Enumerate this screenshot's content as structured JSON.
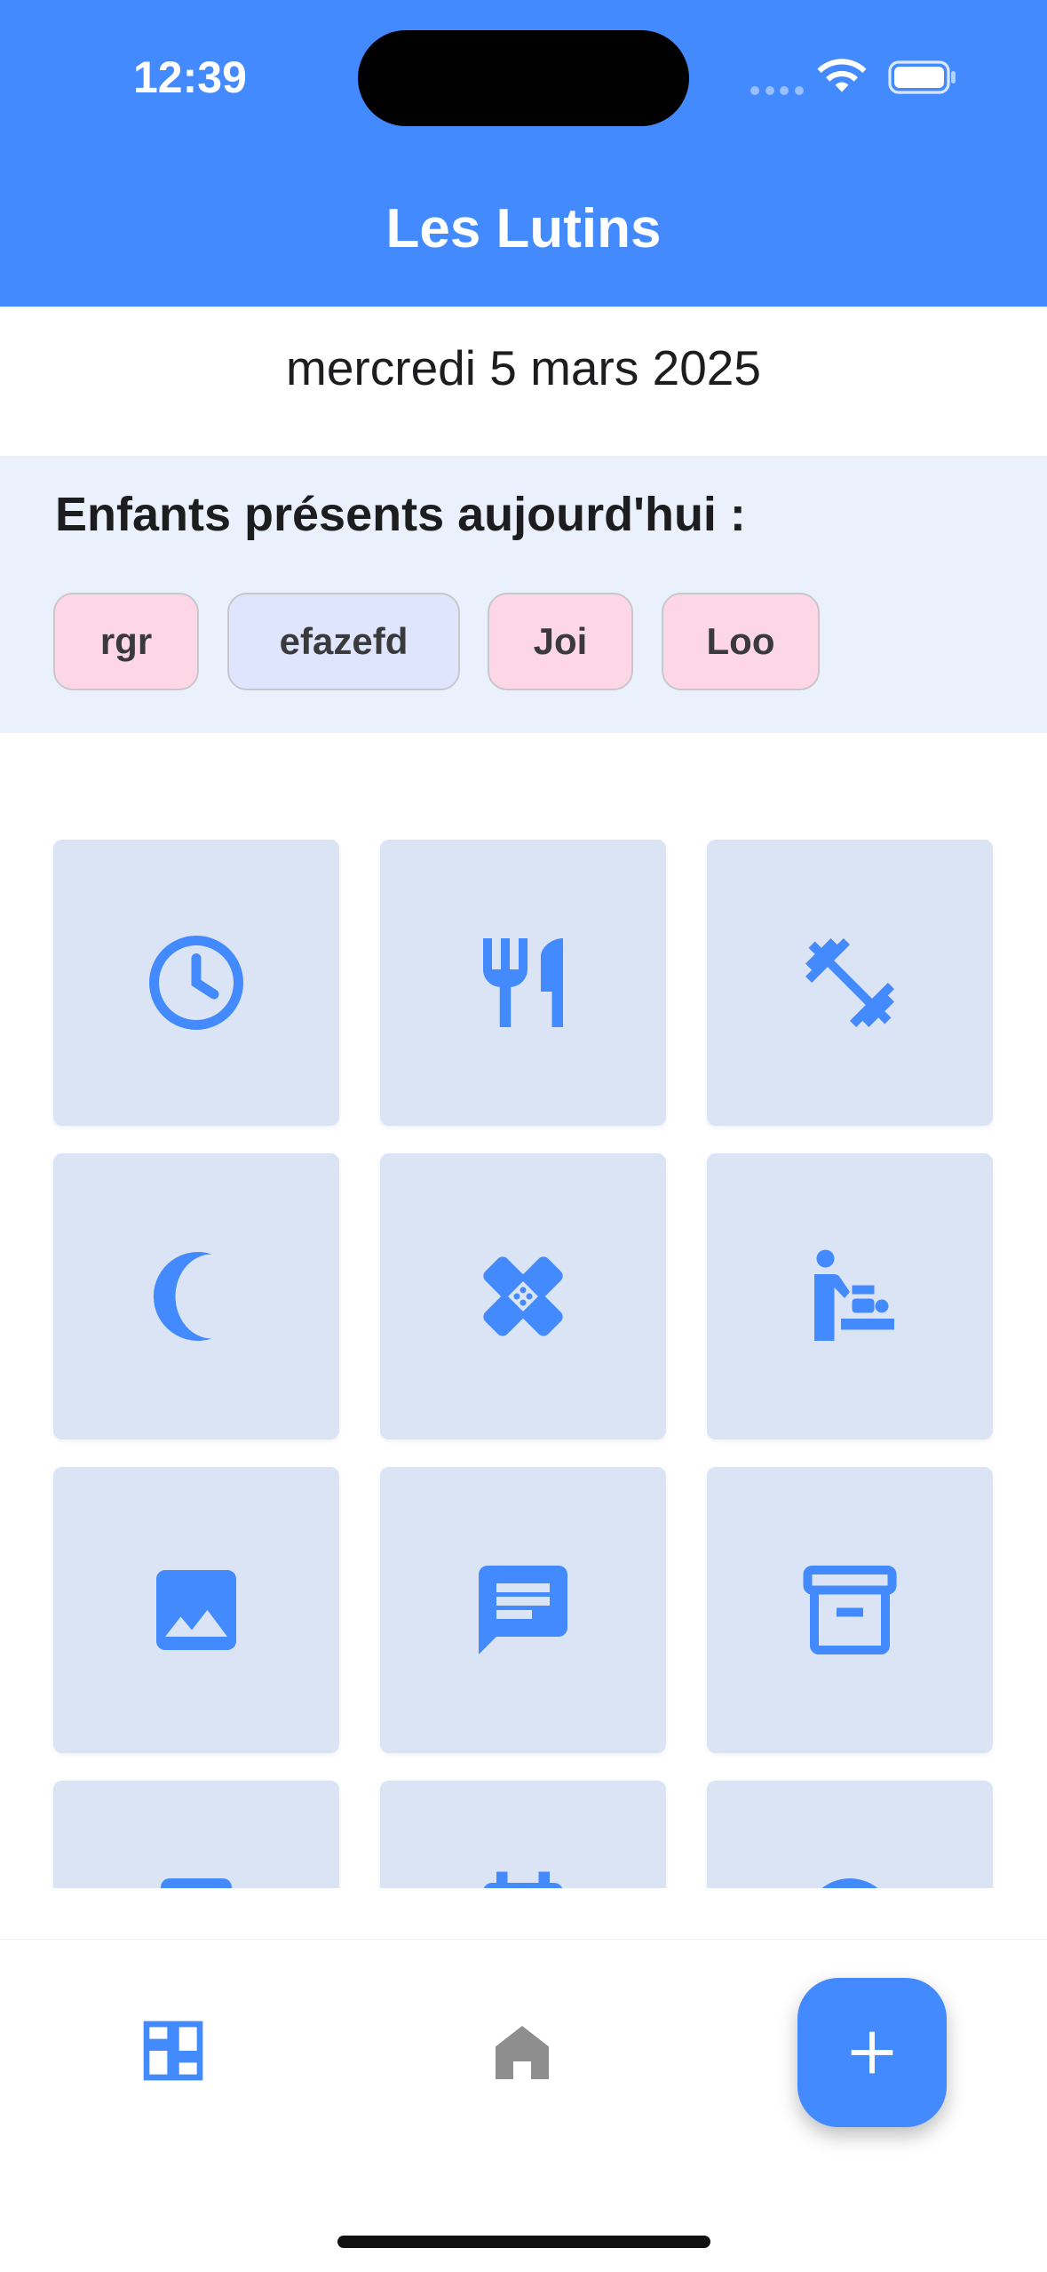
{
  "status_bar": {
    "time": "12:39"
  },
  "header": {
    "title": "Les Lutins"
  },
  "date": "mercredi 5 mars 2025",
  "present": {
    "heading": "Enfants présents aujourd'hui :",
    "children": [
      {
        "name": "rgr",
        "color": "#FDD7E6"
      },
      {
        "name": "efazefd",
        "color": "#DEE5FC"
      },
      {
        "name": "Joi",
        "color": "#FDD7E6"
      },
      {
        "name": "Loo",
        "color": "#FDD7E6"
      }
    ]
  },
  "activity_grid": {
    "tiles": [
      {
        "icon": "clock-icon"
      },
      {
        "icon": "restaurant-icon"
      },
      {
        "icon": "fitness-icon"
      },
      {
        "icon": "moon-icon"
      },
      {
        "icon": "bandage-icon"
      },
      {
        "icon": "baby-changing-icon"
      },
      {
        "icon": "image-icon"
      },
      {
        "icon": "message-icon"
      },
      {
        "icon": "archive-icon"
      },
      {
        "icon": "partial-icon"
      },
      {
        "icon": "calendar-icon"
      },
      {
        "icon": "partial-icon"
      }
    ]
  },
  "bottom_nav": {
    "items": [
      {
        "icon": "dashboard-icon"
      },
      {
        "icon": "home-icon"
      }
    ],
    "fab_icon": "plus-icon"
  },
  "colors": {
    "primary": "#448AFF",
    "tile_bg": "#DAE4F5",
    "panel_bg": "#EAF1FD"
  }
}
